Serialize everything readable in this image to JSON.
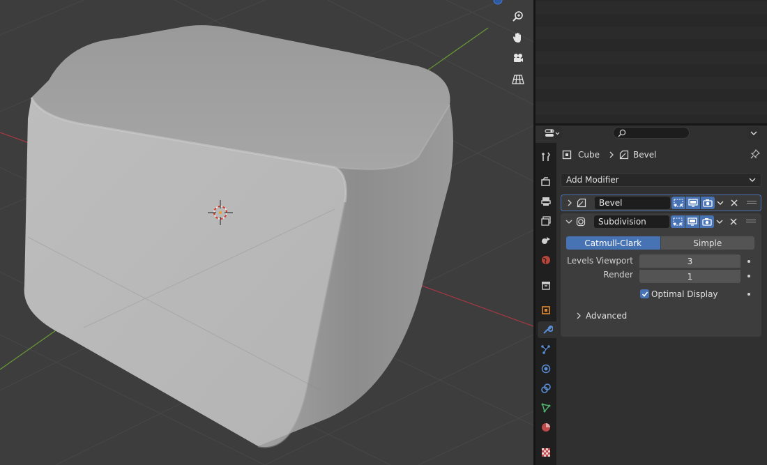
{
  "properties": {
    "search": {
      "placeholder": ""
    },
    "breadcrumb": {
      "object": "Cube",
      "modifier": "Bevel"
    },
    "add_modifier_label": "Add Modifier",
    "modifiers": [
      {
        "name": "Bevel",
        "expanded": false,
        "icon": "bevel-modifier-icon"
      },
      {
        "name": "Subdivision",
        "expanded": true,
        "icon": "subdivision-modifier-icon"
      }
    ],
    "subdivision": {
      "modes": [
        "Catmull-Clark",
        "Simple"
      ],
      "active_mode": "Catmull-Clark",
      "levels_viewport_label": "Levels Viewport",
      "levels_viewport_value": "3",
      "render_label": "Render",
      "render_value": "1",
      "optimal_display_label": "Optimal Display",
      "optimal_display_checked": true,
      "advanced_label": "Advanced"
    },
    "tabs": [
      "tool-icon",
      "render-icon",
      "output-icon",
      "view-layer-icon",
      "scene-icon",
      "world-icon",
      "collection-icon",
      "object-icon",
      "modifier-icon",
      "particles-icon",
      "physics-icon",
      "constraints-icon",
      "data-icon",
      "material-icon",
      "texture-icon"
    ],
    "active_tab": "modifier-icon"
  },
  "viewport": {
    "gizmos": [
      "zoom-icon",
      "pan-hand-icon",
      "camera-icon",
      "perspective-grid-icon"
    ]
  },
  "colors": {
    "accent": "#4772b3",
    "viewport_bg": "#3d3d3d",
    "panel_bg": "#303030",
    "x_axis": "#a83744",
    "y_axis": "#6a9a36"
  }
}
